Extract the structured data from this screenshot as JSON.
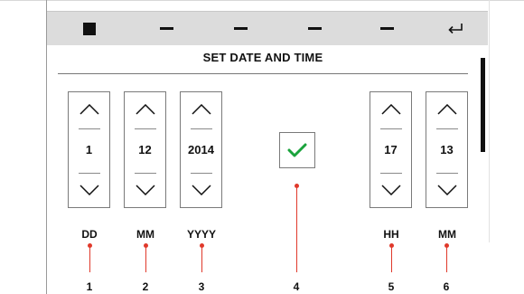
{
  "toolbar": {
    "buttons": [
      {
        "name": "stop",
        "icon": "stop-icon"
      },
      {
        "name": "dash-1",
        "icon": "dash-icon"
      },
      {
        "name": "dash-2",
        "icon": "dash-icon"
      },
      {
        "name": "dash-3",
        "icon": "dash-icon"
      },
      {
        "name": "dash-4",
        "icon": "dash-icon"
      },
      {
        "name": "enter",
        "icon": "return-arrow-icon"
      }
    ]
  },
  "header": {
    "title": "SET DATE AND TIME"
  },
  "spinners": {
    "day": {
      "value": "1",
      "label": "DD"
    },
    "month": {
      "value": "12",
      "label": "MM"
    },
    "year": {
      "value": "2014",
      "label": "YYYY"
    },
    "hour": {
      "value": "17",
      "label": "HH"
    },
    "minute": {
      "value": "13",
      "label": "MM"
    }
  },
  "confirm": {
    "icon": "checkmark-icon",
    "color": "#1aa33c"
  },
  "callouts": [
    "1",
    "2",
    "3",
    "4",
    "5",
    "6"
  ],
  "colors": {
    "callout": "#e0392b",
    "toolbar": "#dcdcdc"
  }
}
